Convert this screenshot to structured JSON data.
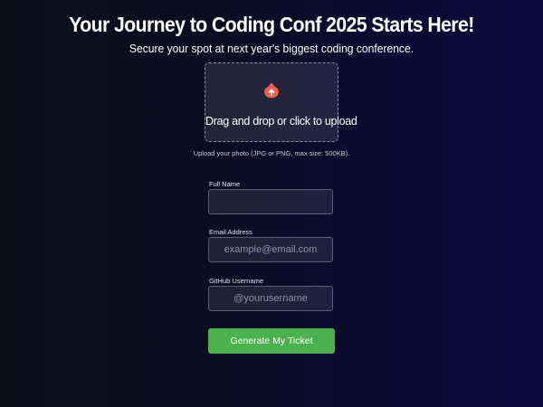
{
  "header": {
    "title": "Your Journey to Coding Conf 2025 Starts Here!",
    "subtitle": "Secure your spot at next year's biggest coding conference."
  },
  "upload": {
    "label": "Drag and drop or click to upload",
    "hint": "Upload your photo (JPG or PNG, max size: 500KB).",
    "icon": "upload-icon",
    "icon_color": "#f25f4c"
  },
  "form": {
    "full_name": {
      "label": "Full Name",
      "value": "",
      "placeholder": ""
    },
    "email": {
      "label": "Email Address",
      "value": "",
      "placeholder": "example@email.com"
    },
    "github": {
      "label": "GitHub Username",
      "value": "",
      "placeholder": "@yourusername"
    },
    "submit_label": "Generate My Ticket"
  },
  "colors": {
    "accent": "#4caf50",
    "upload_icon": "#f25f4c"
  }
}
